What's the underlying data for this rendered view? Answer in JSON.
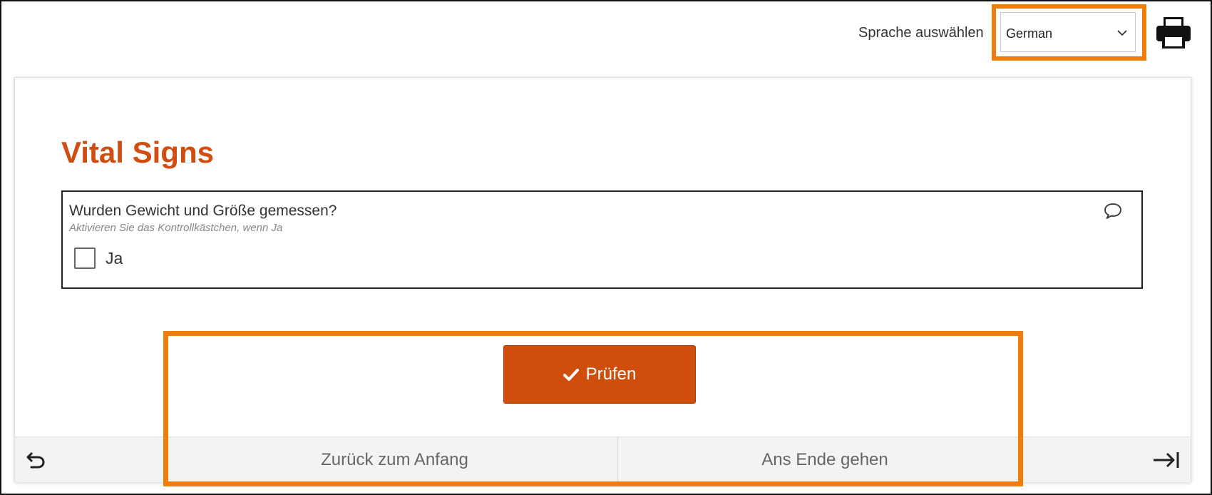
{
  "header": {
    "language_label": "Sprache auswählen",
    "language_selected": "German",
    "icons": {
      "dropdown": "chevron-down-icon",
      "print": "printer-icon"
    }
  },
  "form": {
    "title": "Vital Signs",
    "question": {
      "text": "Wurden Gewicht und Größe gemessen?",
      "hint": "Aktivieren Sie das Kontrollkästchen, wenn Ja",
      "checkbox_label": "Ja",
      "checked": false,
      "comment_icon": "comment-icon"
    },
    "submit_label": "Prüfen",
    "submit_icon": "checkmark-icon"
  },
  "footer": {
    "back_label": "Zurück zum Anfang",
    "end_label": "Ans Ende gehen",
    "icons": {
      "back": "undo-arrow-icon",
      "end": "arrow-to-end-icon"
    }
  },
  "colors": {
    "accent": "#d04e0c",
    "title": "#d04e12",
    "highlight": "#ef7d0e"
  }
}
